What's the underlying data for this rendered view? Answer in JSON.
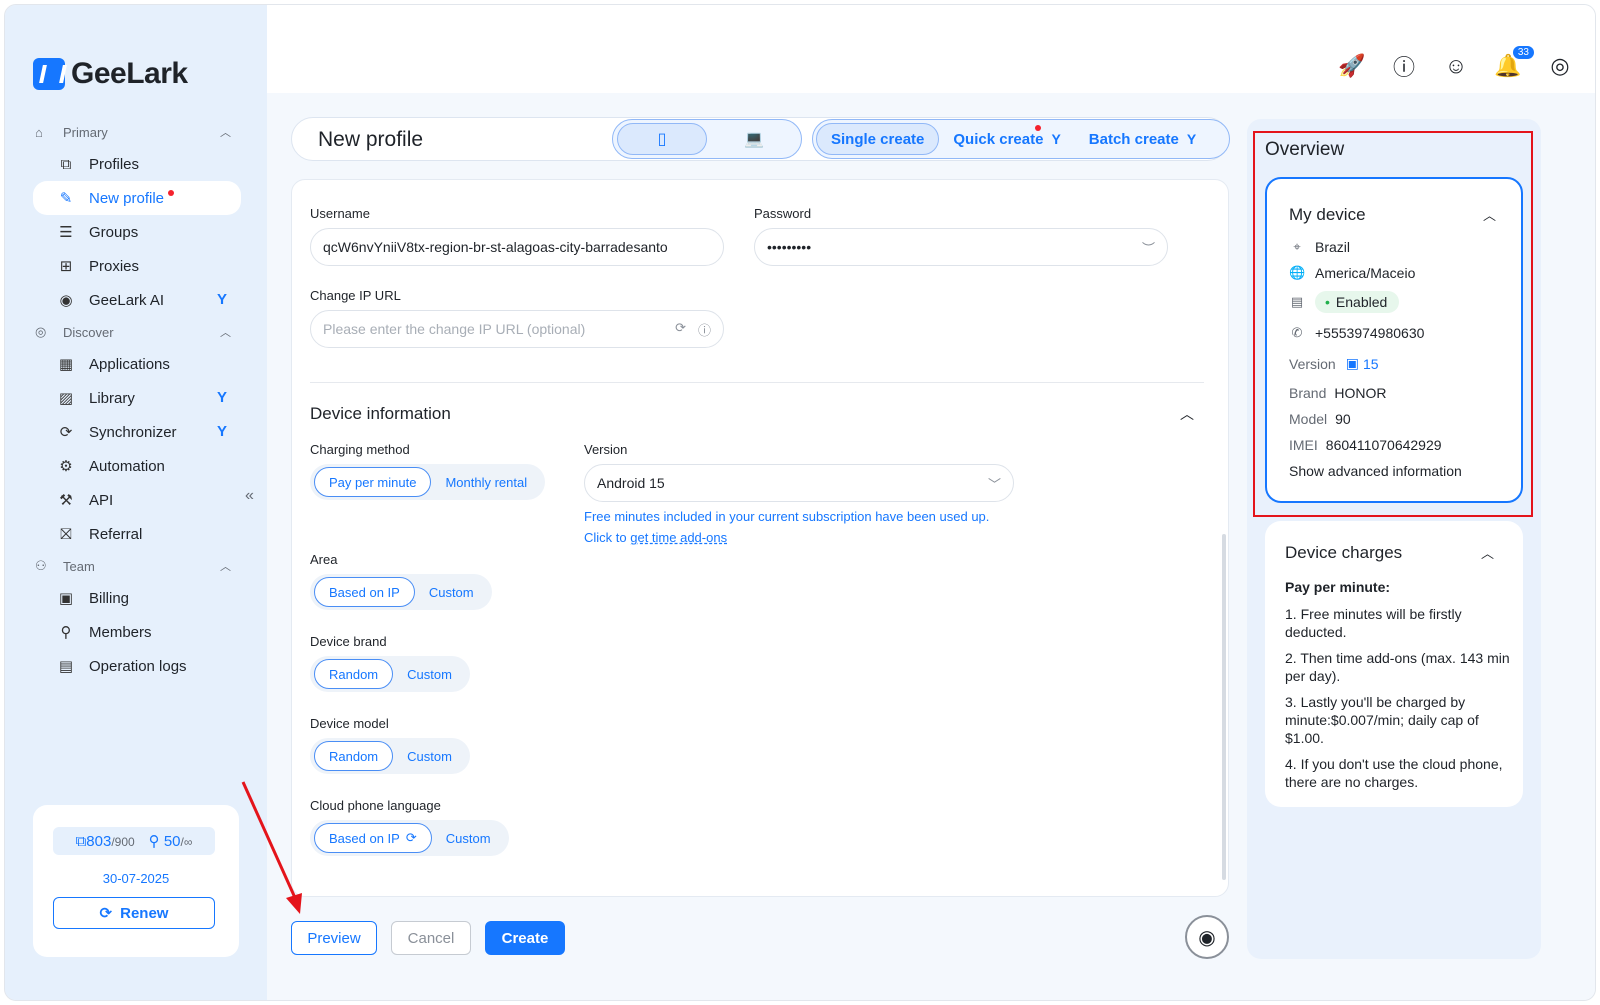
{
  "app": {
    "name": "GeeLark"
  },
  "sidebar": {
    "sections": [
      {
        "label": "Primary",
        "icon": "home-icon",
        "items": [
          {
            "label": "Profiles",
            "icon": "profiles-icon"
          },
          {
            "label": "New profile",
            "icon": "edit-icon",
            "active": true,
            "dot": true
          },
          {
            "label": "Groups",
            "icon": "list-icon"
          },
          {
            "label": "Proxies",
            "icon": "network-icon"
          },
          {
            "label": "GeeLark AI",
            "icon": "ai-eye-icon",
            "star": true
          }
        ]
      },
      {
        "label": "Discover",
        "icon": "planet-icon",
        "items": [
          {
            "label": "Applications",
            "icon": "grid-icon"
          },
          {
            "label": "Library",
            "icon": "library-icon",
            "star": true
          },
          {
            "label": "Synchronizer",
            "icon": "sync-icon",
            "star": true
          },
          {
            "label": "Automation",
            "icon": "robot-icon"
          },
          {
            "label": "API",
            "icon": "api-icon"
          },
          {
            "label": "Referral",
            "icon": "gift-icon"
          }
        ]
      },
      {
        "label": "Team",
        "icon": "team-icon",
        "items": [
          {
            "label": "Billing",
            "icon": "wallet-icon"
          },
          {
            "label": "Members",
            "icon": "user-icon"
          },
          {
            "label": "Operation logs",
            "icon": "log-icon"
          }
        ]
      }
    ],
    "plan": {
      "profiles_used": "803",
      "profiles_total": "/900",
      "members": "50",
      "members_total": "/∞",
      "expiry": "30-07-2025",
      "renew_label": "Renew"
    }
  },
  "topbar": {
    "notification_count": "33"
  },
  "header": {
    "title": "New profile",
    "tabs": {
      "single": "Single create",
      "quick": "Quick create",
      "batch": "Batch create"
    }
  },
  "form": {
    "username_label": "Username",
    "username_value": "qcW6nvYniiV8tx-region-br-st-alagoas-city-barradesanto",
    "password_label": "Password",
    "password_value": "•••••••••",
    "change_ip_label": "Change IP URL",
    "change_ip_placeholder": "Please enter the change IP URL (optional)",
    "device_info_title": "Device information",
    "charging_label": "Charging method",
    "charging_options": [
      "Pay per minute",
      "Monthly rental"
    ],
    "version_label": "Version",
    "version_value": "Android 15",
    "version_hint_1": "Free minutes included in your current subscription have been used up.",
    "version_hint_2_prefix": "Click to ",
    "version_hint_2_link": "get time add-ons",
    "area_label": "Area",
    "area_options": [
      "Based on IP",
      "Custom"
    ],
    "brand_label": "Device brand",
    "brand_options": [
      "Random",
      "Custom"
    ],
    "model_label": "Device model",
    "model_options": [
      "Random",
      "Custom"
    ],
    "language_label": "Cloud phone language",
    "language_options": [
      "Based on IP",
      "Custom"
    ]
  },
  "actions": {
    "preview": "Preview",
    "cancel": "Cancel",
    "create": "Create"
  },
  "overview": {
    "title": "Overview",
    "my_device": {
      "title": "My device",
      "country": "Brazil",
      "timezone": "America/Maceio",
      "status": "Enabled",
      "phone": "+5553974980630",
      "version_key": "Version",
      "version_value": "15",
      "brand_key": "Brand",
      "brand_value": "HONOR",
      "model_key": "Model",
      "model_value": "90",
      "imei_key": "IMEI",
      "imei_value": "860411070642929",
      "advanced_link": "Show advanced information"
    },
    "charges": {
      "title": "Device charges",
      "subtitle": "Pay per minute:",
      "items": [
        "1. Free minutes will be firstly deducted.",
        "2. Then time add-ons (max. 143 min per day).",
        "3. Lastly you'll be charged by minute:$0.007/min; daily cap of $1.00.",
        "4. If you don't use the cloud phone, there are no charges."
      ]
    }
  },
  "colors": {
    "accent": "#1677ff",
    "annotation": "#e4141b",
    "status_green": "#20b04b"
  }
}
